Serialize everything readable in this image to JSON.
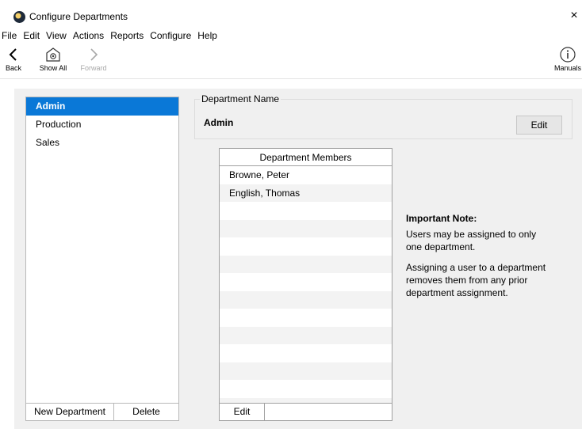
{
  "window": {
    "title": "Configure Departments",
    "close_glyph": "×"
  },
  "menu": [
    "File",
    "Edit",
    "View",
    "Actions",
    "Reports",
    "Configure",
    "Help"
  ],
  "toolbar": {
    "back_label": "Back",
    "show_all_label": "Show All",
    "forward_label": "Forward",
    "manuals_label": "Manuals"
  },
  "departments": {
    "items": [
      "Admin",
      "Production",
      "Sales"
    ],
    "selected": "Admin",
    "new_button": "New Department",
    "delete_button": "Delete"
  },
  "department_name": {
    "legend": "Department Name",
    "value": "Admin",
    "edit_button": "Edit"
  },
  "members": {
    "header": "Department Members",
    "rows": [
      "Browne, Peter",
      "English, Thomas"
    ],
    "edit_button": "Edit"
  },
  "note": {
    "title": "Important Note:",
    "line1": "Users may be assigned to only one department.",
    "line2": "Assigning a user to a department removes them from any prior department assignment."
  },
  "colors": {
    "selection": "#0a78d7",
    "panel_bg": "#f0f0f0"
  },
  "icons": {
    "back": "chevron-left-icon",
    "show_all": "gear-house-icon",
    "forward": "chevron-right-icon",
    "manuals": "info-icon"
  }
}
